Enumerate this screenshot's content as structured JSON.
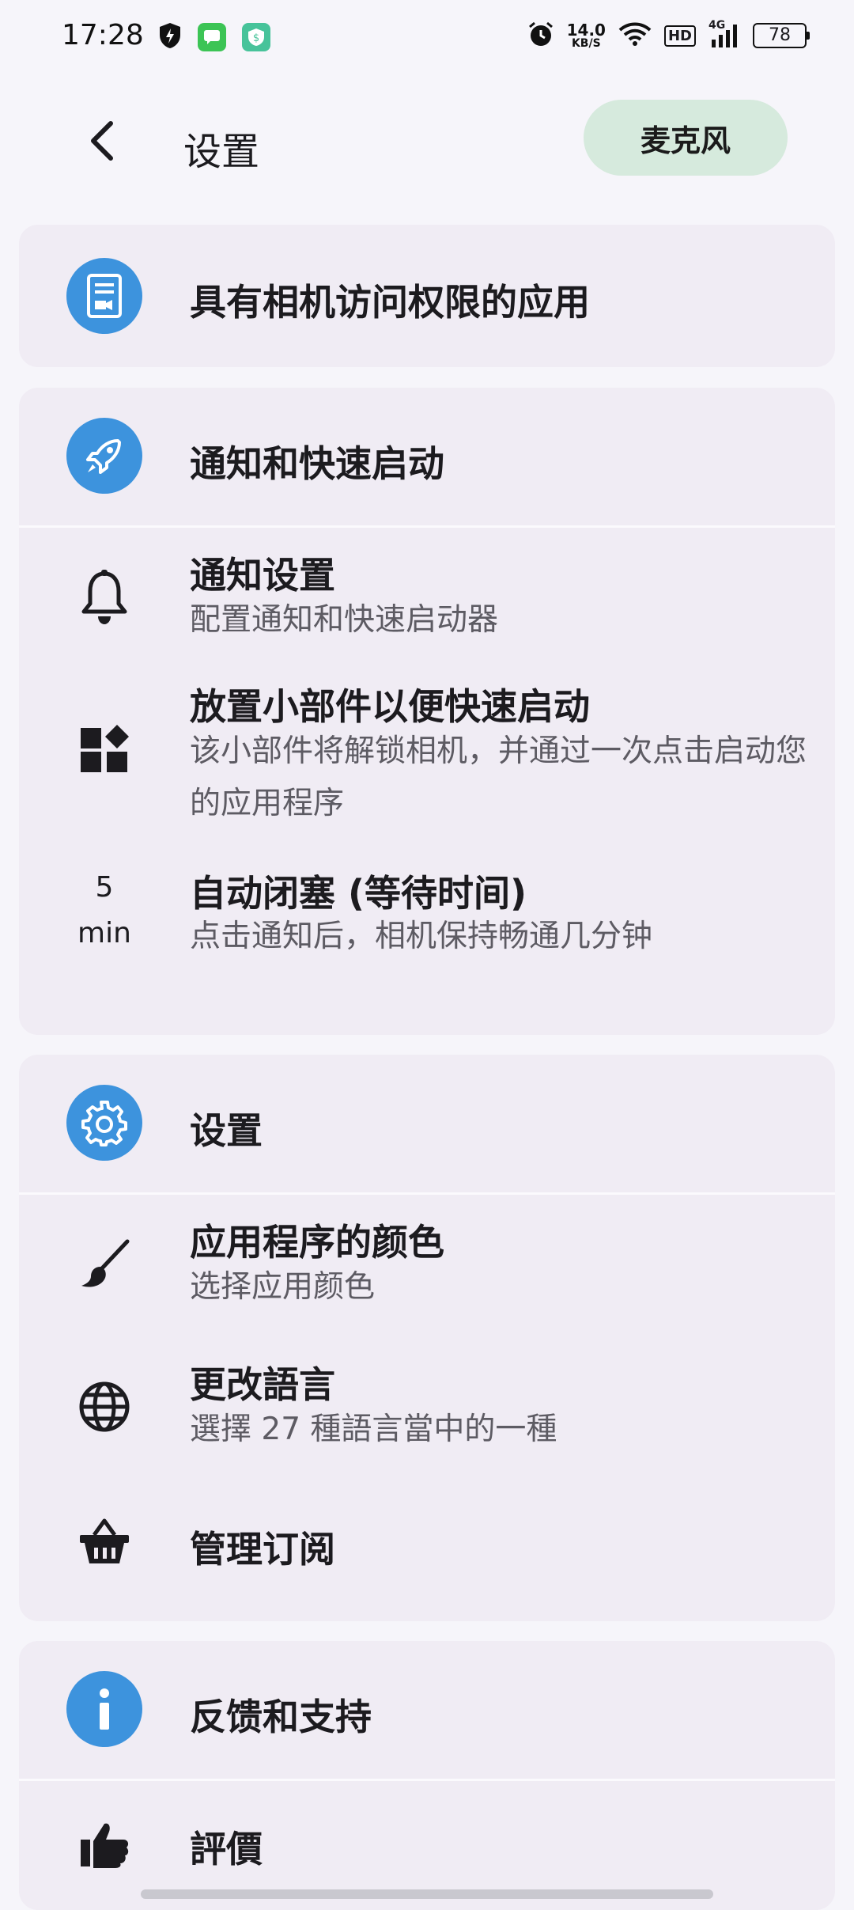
{
  "status_bar": {
    "time": "17:28",
    "net_speed_value": "14.0",
    "net_speed_unit": "KB/S",
    "hd": "HD",
    "network": "4G",
    "battery": "78"
  },
  "top_bar": {
    "title": "设置",
    "mic_button": "麦克风"
  },
  "camera_card": {
    "title": "具有相机访问权限的应用"
  },
  "notifications_card": {
    "title": "通知和快速启动",
    "items": [
      {
        "title": "通知设置",
        "subtitle": "配置通知和快速启动器"
      },
      {
        "title": "放置小部件以便快速启动",
        "subtitle": "该小部件将解锁相机，并通过一次点击启动您的应用程序"
      },
      {
        "title": "自动闭塞 (等待时间)",
        "subtitle": "点击通知后，相机保持畅通几分钟",
        "value": "5",
        "unit": "min"
      }
    ]
  },
  "settings_card": {
    "title": "设置",
    "items": [
      {
        "title": "应用程序的颜色",
        "subtitle": "选择应用颜色"
      },
      {
        "title": "更改語言",
        "subtitle": "選擇 27 種語言當中的一種"
      },
      {
        "title": "管理订阅"
      }
    ]
  },
  "feedback_card": {
    "title": "反馈和支持",
    "items": [
      {
        "title": "評價"
      }
    ]
  },
  "colors": {
    "accent_circle": "#3d93dd",
    "card_bg": "#f0ecf4",
    "mic_button_bg": "#d6eadd"
  }
}
